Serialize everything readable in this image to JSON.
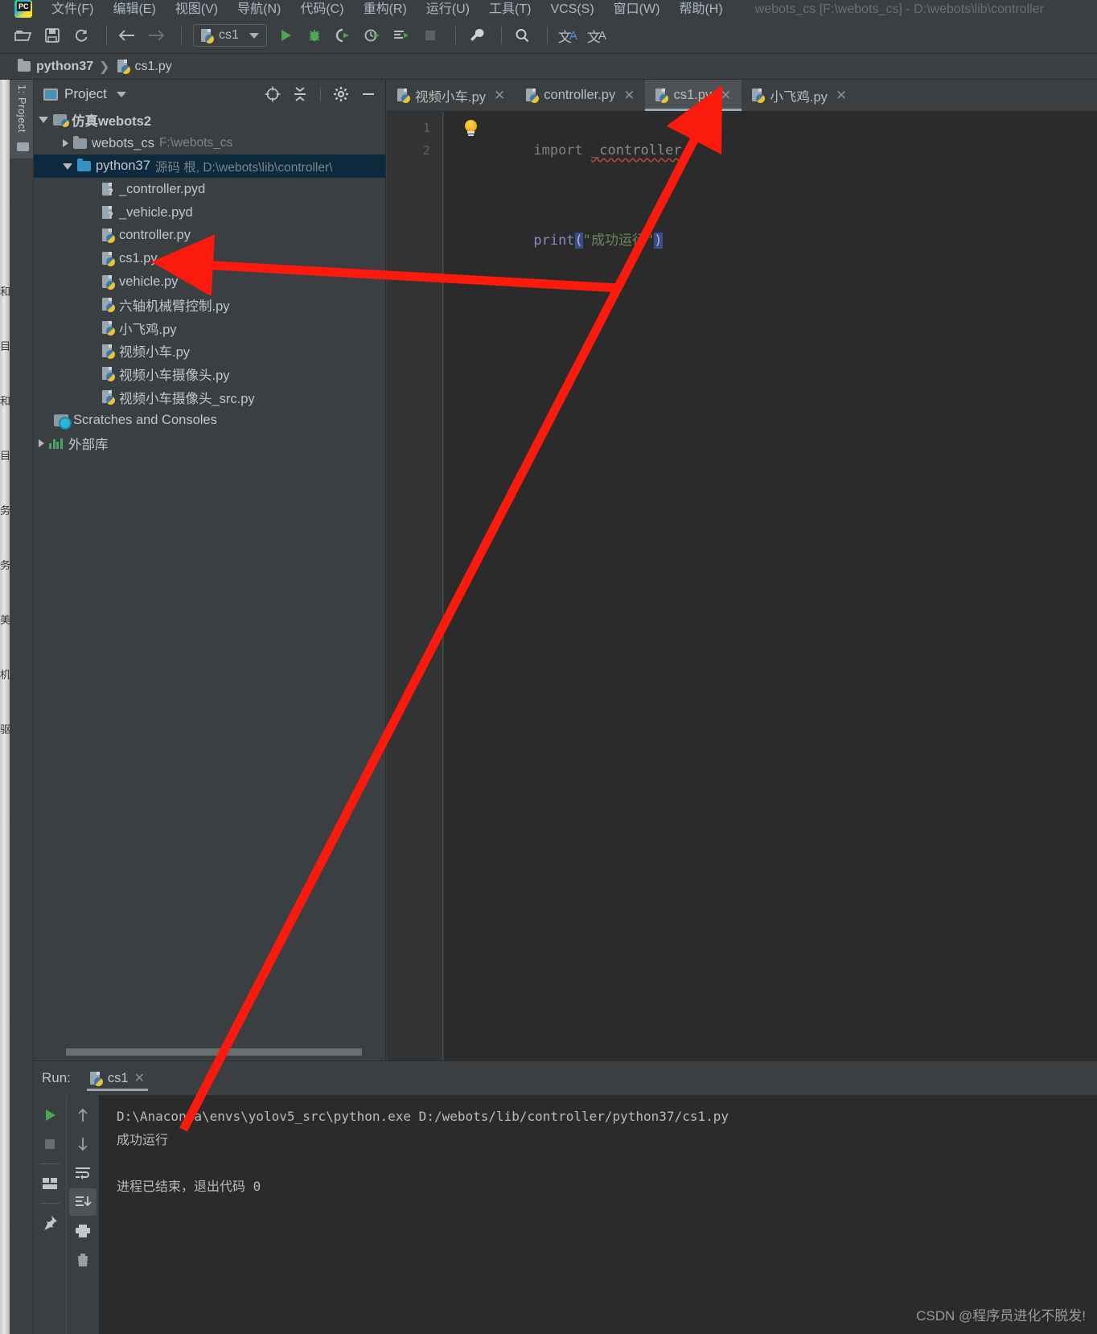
{
  "window": {
    "title": "webots_cs [F:\\webots_cs] - D:\\webots\\lib\\controller",
    "app_icon": "pycharm-logo-icon"
  },
  "menu": {
    "items": [
      {
        "label": "文件(F)"
      },
      {
        "label": "编辑(E)"
      },
      {
        "label": "视图(V)"
      },
      {
        "label": "导航(N)"
      },
      {
        "label": "代码(C)"
      },
      {
        "label": "重构(R)"
      },
      {
        "label": "运行(U)"
      },
      {
        "label": "工具(T)"
      },
      {
        "label": "VCS(S)"
      },
      {
        "label": "窗口(W)"
      },
      {
        "label": "帮助(H)"
      }
    ]
  },
  "toolbar": {
    "open_icon": "open-folder-icon",
    "save_icon": "save-icon",
    "sync_icon": "sync-icon",
    "back_icon": "arrow-left-icon",
    "forward_icon": "arrow-right-icon",
    "run_config_name": "cs1",
    "run_icon": "run-play-icon",
    "debug_icon": "debug-bug-icon",
    "coverage_icon": "run-coverage-icon",
    "profile_icon": "run-profile-icon",
    "run_with_console_icon": "run-console-icon",
    "stop_icon": "stop-icon",
    "settings_icon": "wrench-icon",
    "search_icon": "search-icon",
    "translate_icon": "translate-icon",
    "translate_alt_icon": "translate-alt-icon"
  },
  "breadcrumb": {
    "folder": "python37",
    "separator": "❯",
    "file": "cs1.py"
  },
  "left_rail": {
    "project_tab_label": "1: Project",
    "structure_icon": "structure-icon"
  },
  "project_panel": {
    "title": "Project",
    "caret_icon": "chevron-down-icon",
    "locate_icon": "target-locate-icon",
    "collapse_icon": "collapse-all-icon",
    "settings_icon": "gear-icon",
    "hide_icon": "minimize-icon",
    "tree": [
      {
        "label": "仿真webots2",
        "detail": "",
        "icon": "project-root-icon",
        "indent": 0,
        "arrow": "open",
        "bold": true,
        "selected": false
      },
      {
        "label": "webots_cs",
        "detail": "F:\\webots_cs",
        "icon": "folder-icon",
        "indent": 1,
        "arrow": "closed",
        "bold": false,
        "selected": false
      },
      {
        "label": "python37",
        "detail": "源码 根, D:\\webots\\lib\\controller\\",
        "icon": "folder-blue-icon",
        "indent": 1,
        "arrow": "open",
        "bold": false,
        "selected": true
      },
      {
        "label": "_controller.pyd",
        "detail": "",
        "icon": "unknown-file-icon",
        "indent": 2,
        "arrow": "none",
        "bold": false,
        "selected": false
      },
      {
        "label": "_vehicle.pyd",
        "detail": "",
        "icon": "unknown-file-icon",
        "indent": 2,
        "arrow": "none",
        "bold": false,
        "selected": false
      },
      {
        "label": "controller.py",
        "detail": "",
        "icon": "python-file-icon",
        "indent": 2,
        "arrow": "none",
        "bold": false,
        "selected": false
      },
      {
        "label": "cs1.py",
        "detail": "",
        "icon": "python-file-icon",
        "indent": 2,
        "arrow": "none",
        "bold": false,
        "selected": false
      },
      {
        "label": "vehicle.py",
        "detail": "",
        "icon": "python-file-icon",
        "indent": 2,
        "arrow": "none",
        "bold": false,
        "selected": false
      },
      {
        "label": "六轴机械臂控制.py",
        "detail": "",
        "icon": "python-file-icon",
        "indent": 2,
        "arrow": "none",
        "bold": false,
        "selected": false
      },
      {
        "label": "小飞鸡.py",
        "detail": "",
        "icon": "python-file-icon",
        "indent": 2,
        "arrow": "none",
        "bold": false,
        "selected": false
      },
      {
        "label": "视频小车.py",
        "detail": "",
        "icon": "python-file-icon",
        "indent": 2,
        "arrow": "none",
        "bold": false,
        "selected": false
      },
      {
        "label": "视频小车摄像头.py",
        "detail": "",
        "icon": "python-file-icon",
        "indent": 2,
        "arrow": "none",
        "bold": false,
        "selected": false
      },
      {
        "label": "视频小车摄像头_src.py",
        "detail": "",
        "icon": "python-file-icon",
        "indent": 2,
        "arrow": "none",
        "bold": false,
        "selected": false
      },
      {
        "label": "Scratches and Consoles",
        "detail": "",
        "icon": "scratches-icon",
        "indent": 0,
        "arrow": "none",
        "bold": false,
        "selected": false
      },
      {
        "label": "外部库",
        "detail": "",
        "icon": "external-libraries-icon",
        "indent": 0,
        "arrow": "closed",
        "bold": false,
        "selected": false
      }
    ]
  },
  "editor": {
    "tabs": [
      {
        "label": "视频小车.py",
        "icon": "python-file-icon",
        "active": false,
        "close_icon": "✕"
      },
      {
        "label": "controller.py",
        "icon": "python-file-icon",
        "active": false,
        "close_icon": "✕"
      },
      {
        "label": "cs1.py",
        "icon": "python-file-icon",
        "active": true,
        "close_icon": "✕"
      },
      {
        "label": "小飞鸡.py",
        "icon": "python-file-icon",
        "active": false,
        "close_icon": "✕"
      }
    ],
    "line_numbers": [
      "1",
      "2"
    ],
    "code": {
      "line1_import": "import",
      "line1_module": "_controller",
      "line2_fn": "print",
      "line2_open": "(",
      "line2_string": "\"成功运行\"",
      "line2_close": ")"
    },
    "intention_bulb_icon": "lightbulb-icon"
  },
  "run_panel": {
    "label": "Run:",
    "tab_name": "cs1",
    "tab_icon": "python-file-icon",
    "tab_close_icon": "✕",
    "rail_left": [
      "rerun-play-icon",
      "stop-icon",
      "layout-icon",
      "pin-icon"
    ],
    "rail_right": [
      "scroll-up-icon",
      "scroll-down-icon",
      "soft-wrap-icon",
      "scroll-to-end-icon",
      "print-icon",
      "trash-icon"
    ],
    "console_lines": [
      "D:\\Anaconda\\envs\\yolov5_src\\python.exe D:/webots/lib/controller/python37/cs1.py",
      "成功运行",
      "",
      "进程已结束，退出代码 0"
    ]
  },
  "watermark": {
    "text": "CSDN @程序员进化不脱发!"
  },
  "annotations": {
    "arrow1_target": "cs1.py tree item",
    "arrow2_target": "cs1.py editor tab",
    "color": "#fb1a0c"
  }
}
